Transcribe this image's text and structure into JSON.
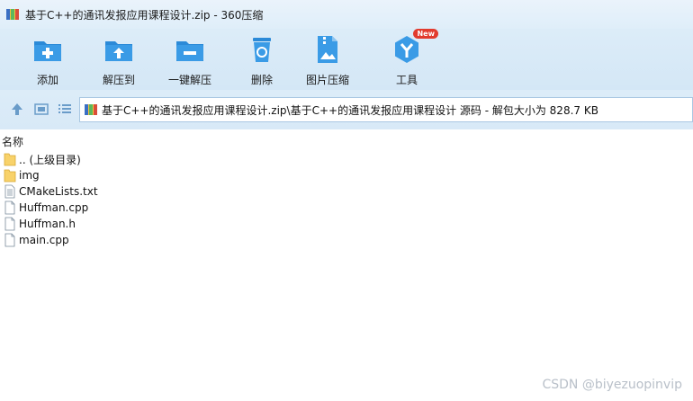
{
  "window": {
    "title": "基于C++的通讯发报应用课程设计.zip - 360压缩"
  },
  "toolbar": {
    "items": [
      {
        "label": "添加",
        "icon": "add-folder-icon"
      },
      {
        "label": "解压到",
        "icon": "extract-to-icon"
      },
      {
        "label": "一键解压",
        "icon": "one-click-extract-icon"
      },
      {
        "label": "删除",
        "icon": "trash-icon"
      },
      {
        "label": "图片压缩",
        "icon": "image-compress-icon"
      },
      {
        "label": "工具",
        "icon": "tools-icon",
        "badge": "New"
      }
    ]
  },
  "nav": {
    "path": "基于C++的通讯发报应用课程设计.zip\\基于C++的通讯发报应用课程设计 源码 - 解包大小为 828.7 KB"
  },
  "list": {
    "header": "名称",
    "items": [
      {
        "name": ".. (上级目录)",
        "type": "folder"
      },
      {
        "name": "img",
        "type": "folder"
      },
      {
        "name": "CMakeLists.txt",
        "type": "file"
      },
      {
        "name": "Huffman.cpp",
        "type": "file"
      },
      {
        "name": "Huffman.h",
        "type": "file"
      },
      {
        "name": "main.cpp",
        "type": "file"
      }
    ]
  },
  "watermark": "CSDN @biyezuopinvip",
  "colors": {
    "accent": "#2b8ad8",
    "toolbar_bg": "#d8eaf8",
    "badge": "#e23b2e"
  }
}
